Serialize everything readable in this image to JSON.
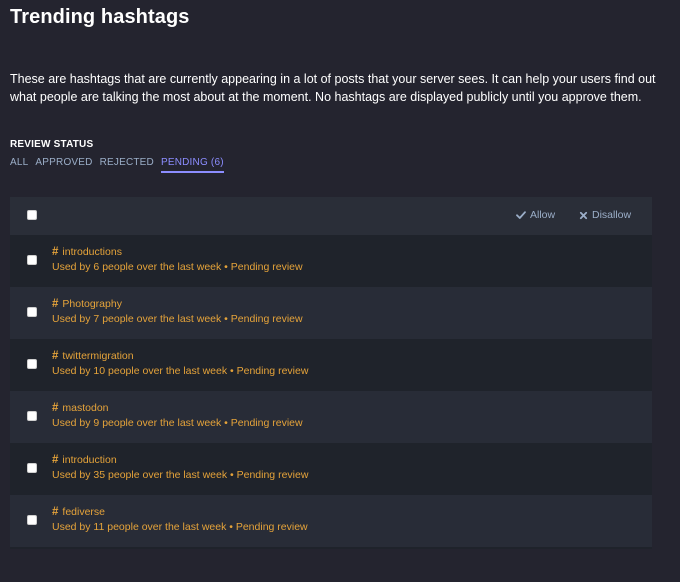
{
  "page": {
    "title": "Trending hashtags",
    "description": "These are hashtags that are currently appearing in a lot of posts that your server sees. It can help your users find out what people are talking the most about at the moment. No hashtags are displayed publicly until you approve them."
  },
  "filter": {
    "label": "REVIEW STATUS",
    "tabs": [
      {
        "label": "ALL",
        "selected": false
      },
      {
        "label": "APPROVED",
        "selected": false
      },
      {
        "label": "REJECTED",
        "selected": false
      },
      {
        "label": "PENDING (6)",
        "selected": true
      }
    ]
  },
  "actions": {
    "allow_label": "Allow",
    "disallow_label": "Disallow"
  },
  "hashtags": [
    {
      "name": "introductions",
      "meta": "Used by 6 people over the last week • Pending review"
    },
    {
      "name": "Photography",
      "meta": "Used by 7 people over the last week • Pending review"
    },
    {
      "name": "twittermigration",
      "meta": "Used by 10 people over the last week • Pending review"
    },
    {
      "name": "mastodon",
      "meta": "Used by 9 people over the last week • Pending review"
    },
    {
      "name": "introduction",
      "meta": "Used by 35 people over the last week • Pending review"
    },
    {
      "name": "fediverse",
      "meta": "Used by 11 people over the last week • Pending review"
    }
  ],
  "colors": {
    "accent": "#8c8dff",
    "hashtag": "#e5a33a",
    "muted": "#9baec8"
  },
  "icons": {
    "hash": "#",
    "allow": "check-icon",
    "disallow": "times-icon"
  }
}
